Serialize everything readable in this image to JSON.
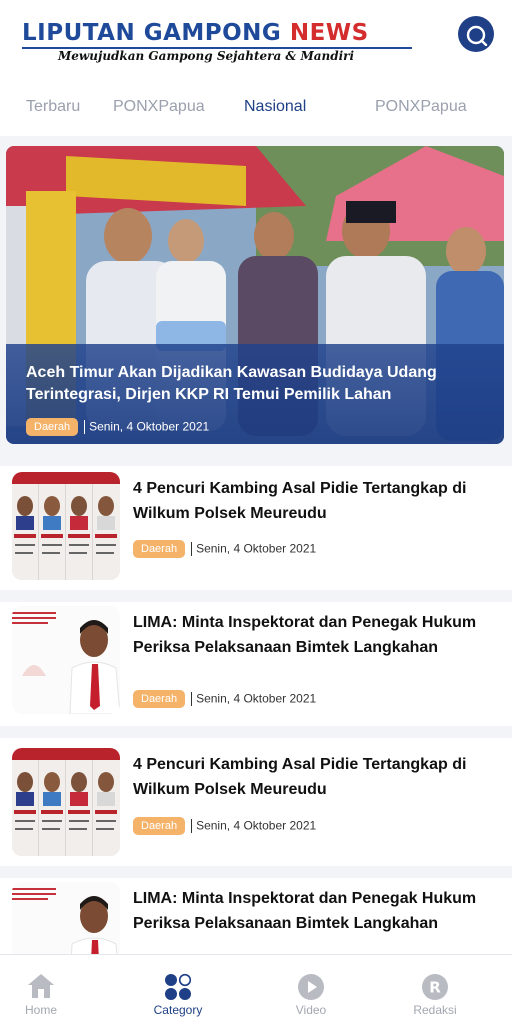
{
  "header": {
    "logo_main": "LIPUTAN GAMPONG ",
    "logo_news": "NEWS",
    "tagline": "Mewujudkan Gampong Sejahtera & Mandiri"
  },
  "tabs": [
    {
      "label": "Terbaru"
    },
    {
      "label": "PONXPapua"
    },
    {
      "label": "Nasional",
      "active": true
    },
    {
      "label": "PONXPapua"
    }
  ],
  "hero": {
    "title": "Aceh Timur Akan Dijadikan Kawasan Budidaya Udang Terintegrasi, Dirjen KKP RI Temui Pemilik Lahan",
    "category": "Daerah",
    "date": "Senin, 4 Oktober 2021"
  },
  "articles": [
    {
      "title": "4 Pencuri Kambing Asal Pidie Tertangkap di Wilkum Polsek Meureudu",
      "category": "Daerah",
      "date": "Senin, 4 Oktober 2021",
      "thumb": "mugshots"
    },
    {
      "title": "LIMA: Minta Inspektorat dan Penegak Hukum Periksa Pelaksanaan Bimtek Langkahan",
      "category": "Daerah",
      "date": "Senin, 4 Oktober 2021",
      "thumb": "portrait"
    },
    {
      "title": "4 Pencuri Kambing Asal Pidie Tertangkap di Wilkum Polsek Meureudu",
      "category": "Daerah",
      "date": "Senin, 4 Oktober 2021",
      "thumb": "mugshots"
    },
    {
      "title": "LIMA: Minta Inspektorat dan Penegak Hukum Periksa Pelaksanaan Bimtek Langkahan",
      "category": "Daerah",
      "date": "Senin, 4 Oktober 2021",
      "thumb": "portrait"
    }
  ],
  "thumb_labels": {
    "mugshot_header": "TST RESKRIM",
    "portrait_header": "LEMBAGA BANTUAN HUKUM"
  },
  "bottom_nav": [
    {
      "label": "Home",
      "icon": "home-icon"
    },
    {
      "label": "Category",
      "icon": "category-icon",
      "active": true
    },
    {
      "label": "Video",
      "icon": "play-icon"
    },
    {
      "label": "Redaksi",
      "icon": "redaksi-icon"
    }
  ],
  "colors": {
    "brand": "#1f3f86",
    "logo_blue": "#1f4a9a",
    "logo_red": "#d32d2d",
    "badge": "#f5b36a",
    "background": "#f3f4f8"
  }
}
